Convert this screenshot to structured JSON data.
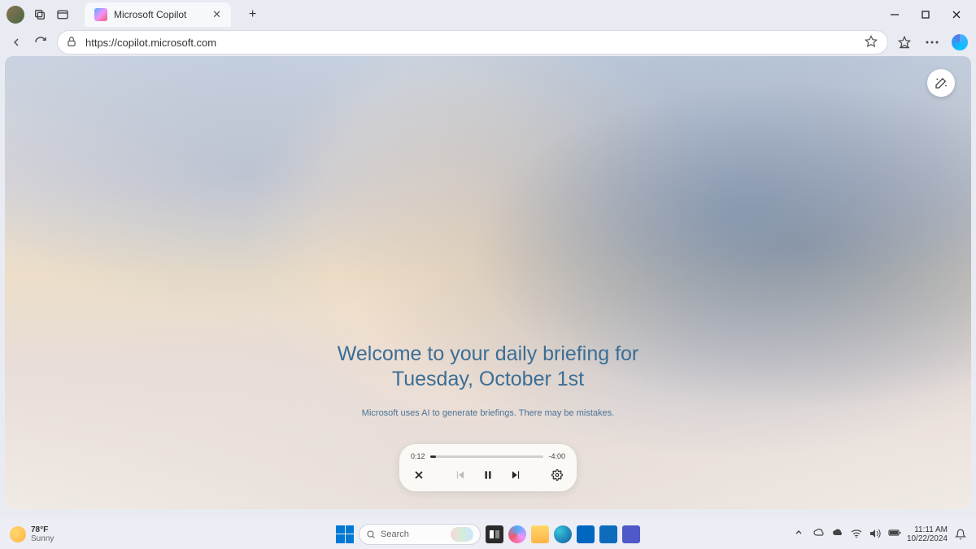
{
  "browser": {
    "tab_title": "Microsoft Copilot",
    "url": "https://copilot.microsoft.com"
  },
  "page": {
    "title_line1": "Welcome to your daily briefing for",
    "title_line2": "Tuesday, October 1st",
    "disclaimer": "Microsoft uses AI to generate briefings. There may be mistakes."
  },
  "player": {
    "current_time": "0:12",
    "remaining_time": "-4:00",
    "progress_percent": 5
  },
  "taskbar": {
    "temp": "78°F",
    "condition": "Sunny",
    "search_placeholder": "Search",
    "time": "11:11 AM",
    "date": "10/22/2024"
  }
}
